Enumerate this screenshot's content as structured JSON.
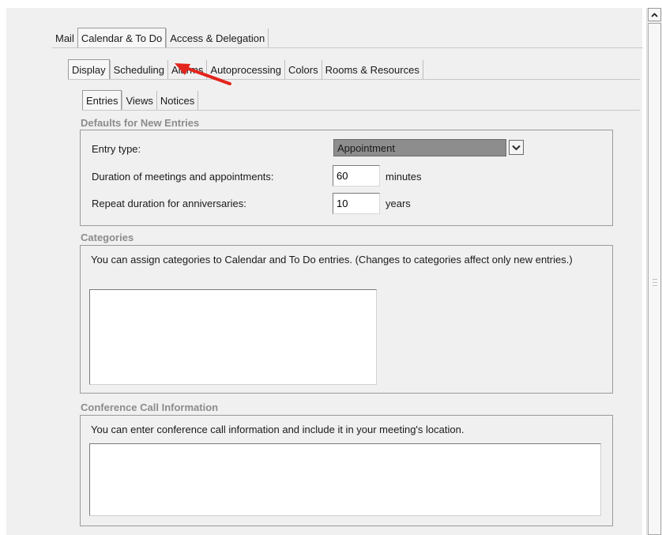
{
  "tabs": {
    "top": [
      {
        "label": "Mail",
        "active": false
      },
      {
        "label": "Calendar & To Do",
        "active": true
      },
      {
        "label": "Access & Delegation",
        "active": false
      }
    ],
    "second": [
      {
        "label": "Display",
        "active": true
      },
      {
        "label": "Scheduling",
        "active": false
      },
      {
        "label": "Alarms",
        "active": false
      },
      {
        "label": "Autoprocessing",
        "active": false
      },
      {
        "label": "Colors",
        "active": false
      },
      {
        "label": "Rooms & Resources",
        "active": false
      }
    ],
    "third": [
      {
        "label": "Entries",
        "active": true
      },
      {
        "label": "Views",
        "active": false
      },
      {
        "label": "Notices",
        "active": false
      }
    ]
  },
  "defaults": {
    "title": "Defaults for New Entries",
    "entry_type_label": "Entry type:",
    "entry_type_value": "Appointment",
    "duration_label": "Duration of meetings and appointments:",
    "duration_value": "60",
    "duration_unit": "minutes",
    "repeat_label": "Repeat duration for anniversaries:",
    "repeat_value": "10",
    "repeat_unit": "years"
  },
  "categories": {
    "title": "Categories",
    "description": "You can assign categories to Calendar and To Do entries.  (Changes to categories affect only new entries.)"
  },
  "conference": {
    "title": "Conference Call Information",
    "description": "You can enter conference call information and include it in your meeting's location."
  },
  "annotation": {
    "arrow_color": "#e3241c"
  },
  "colors": {
    "tab_border": "#bdbdbd",
    "section_title": "#8c8c8c",
    "selected_bg": "#8d8d8d"
  }
}
